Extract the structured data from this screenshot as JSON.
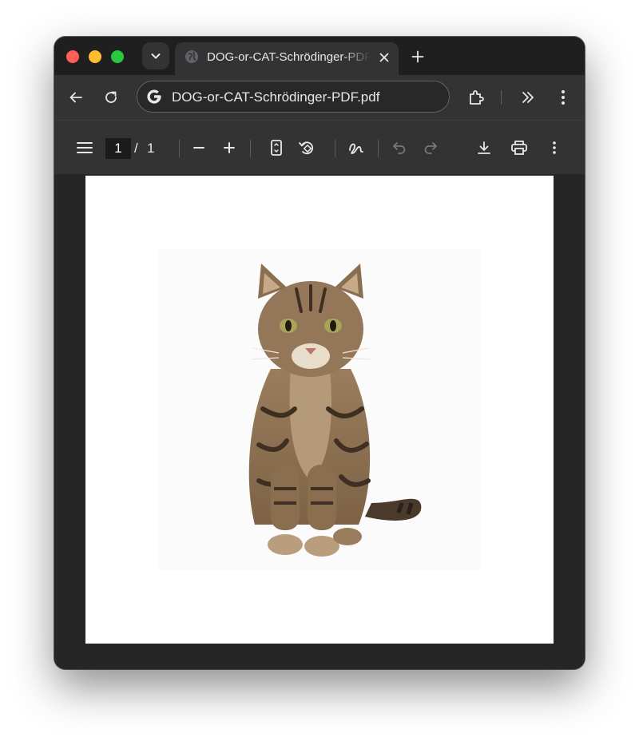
{
  "window": {
    "tab": {
      "title": "DOG-or-CAT-Schrödinger-PDF.pdf",
      "favicon": "globe-icon"
    }
  },
  "toolbar": {
    "url": "DOG-or-CAT-Schrödinger-PDF.pdf",
    "search_engine_icon": "google-g-icon"
  },
  "pdf_viewer": {
    "current_page": "1",
    "page_separator": "/",
    "total_pages": "1"
  },
  "colors": {
    "chrome_dark": "#1f1f1f",
    "toolbar": "#333333",
    "viewport": "#262626",
    "close": "#ff5f57",
    "minimize": "#febc2e",
    "maximize": "#28c840"
  },
  "document": {
    "image": "tabby-cat-photo"
  }
}
